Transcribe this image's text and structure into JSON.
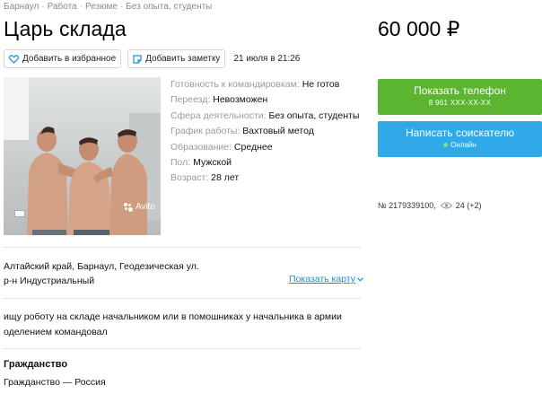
{
  "breadcrumbs": [
    "Барнаул",
    "Работа",
    "Резюме",
    "Без опыта, студенты"
  ],
  "breadcrumb_separator": "·",
  "title": "Царь склада",
  "price": "60 000 ₽",
  "actions": {
    "favorite_label": "Добавить в избранное",
    "note_label": "Добавить заметку",
    "date": "21 июля в 21:26"
  },
  "photo": {
    "watermark": "Avito"
  },
  "details": [
    {
      "label": "Готовность к командировкам:",
      "value": "Не готов"
    },
    {
      "label": "Переезд:",
      "value": "Невозможен"
    },
    {
      "label": "Сфера деятельности:",
      "value": "Без опыта, студенты"
    },
    {
      "label": "График работы:",
      "value": "Вахтовый метод"
    },
    {
      "label": "Образование:",
      "value": "Среднее"
    },
    {
      "label": "Пол:",
      "value": "Мужской"
    },
    {
      "label": "Возраст:",
      "value": "28 лет"
    }
  ],
  "phone_button": {
    "label": "Показать телефон",
    "number": "8 961 XXX-XX-XX"
  },
  "message_button": {
    "label": "Написать соискателю",
    "status": "Онлайн"
  },
  "listing": {
    "id": "№ 2179339100,",
    "views": "24 (+2)"
  },
  "address": {
    "line1": "Алтайский край, Барнаул, Геодезическая ул.",
    "line2": "р-н Индустриальный",
    "map_link": "Показать карту"
  },
  "description": "ищу роботу на складе начальником или в помошниках у начальника в армии оделением командовал",
  "citizenship": {
    "title": "Гражданство",
    "value": "Гражданство — Россия"
  },
  "colors": {
    "phone_button": "#5cb531",
    "message_button": "#2fa9e8",
    "link": "#1a8fd6",
    "muted_label": "#9a9a9a"
  }
}
